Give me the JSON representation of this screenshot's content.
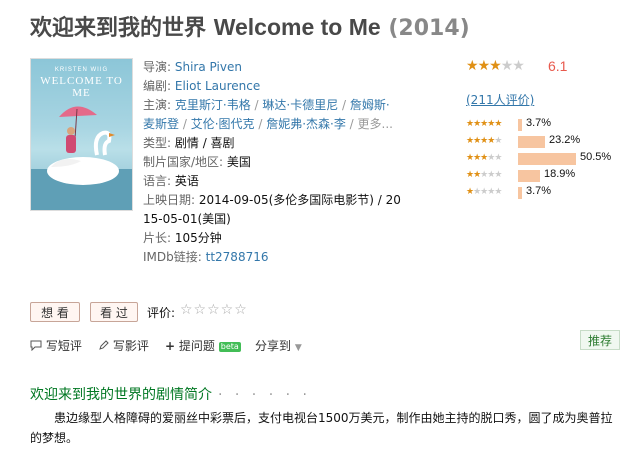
{
  "title": {
    "cn": "欢迎来到我的世界",
    "en": "Welcome to Me",
    "year": "(2014)"
  },
  "poster": {
    "line1": "KRISTEN WIIG",
    "line2": "WELCOME TO ME"
  },
  "info": {
    "director_label": "导演:",
    "director": "Shira Piven",
    "writer_label": "编剧:",
    "writer": "Eliot Laurence",
    "cast_label": "主演:",
    "cast_line1": [
      "克里斯汀·韦格",
      "琳达·卡德里尼",
      "詹姆斯·"
    ],
    "cast_line2": [
      "麦斯登",
      "艾伦·图代克",
      "詹妮弗·杰森·李"
    ],
    "cast_sep": " / ",
    "cast_more": "更多...",
    "genre_label": "类型:",
    "genre": "剧情 / 喜剧",
    "country_label": "制片国家/地区:",
    "country": "美国",
    "language_label": "语言:",
    "language": "英语",
    "release_label": "上映日期:",
    "release_line1": "2014-09-05(多伦多国际电影节) / 20",
    "release_line2": "15-05-01(美国)",
    "runtime_label": "片长:",
    "runtime": "105分钟",
    "imdb_label": "IMDb链接:",
    "imdb": "tt2788716"
  },
  "rating": {
    "score": "6.1",
    "stars_value": 3,
    "votes_text": "(211人评价)",
    "bars": [
      {
        "stars": 5,
        "percent": 3.7,
        "label": "3.7%"
      },
      {
        "stars": 4,
        "percent": 23.2,
        "label": "23.2%"
      },
      {
        "stars": 3,
        "percent": 50.5,
        "label": "50.5%"
      },
      {
        "stars": 2,
        "percent": 18.9,
        "label": "18.9%"
      },
      {
        "stars": 1,
        "percent": 3.7,
        "label": "3.7%"
      }
    ],
    "bar_color": "#f7c5a0",
    "star_color": "#e09015"
  },
  "actions": {
    "want": "想 看",
    "seen": "看 过",
    "rate_label": "评价:",
    "rate_stars": "☆☆☆☆☆"
  },
  "tools": {
    "short_review": "写短评",
    "review": "写影评",
    "ask": "提问题",
    "beta": "beta",
    "share": "分享到",
    "recommend": "推荐"
  },
  "summary": {
    "heading": "欢迎来到我的世界的剧情简介",
    "dots": "· · · · · ·",
    "text": "患边缘型人格障碍的爱丽丝中彩票后，支付电视台1500万美元，制作由她主持的脱口秀，圆了成为奥普拉的梦想。"
  },
  "icons": {
    "comment": "speech-bubble-icon",
    "pen": "pencil-icon",
    "plus": "plus-icon",
    "share_arrow": "caret-down-icon"
  }
}
